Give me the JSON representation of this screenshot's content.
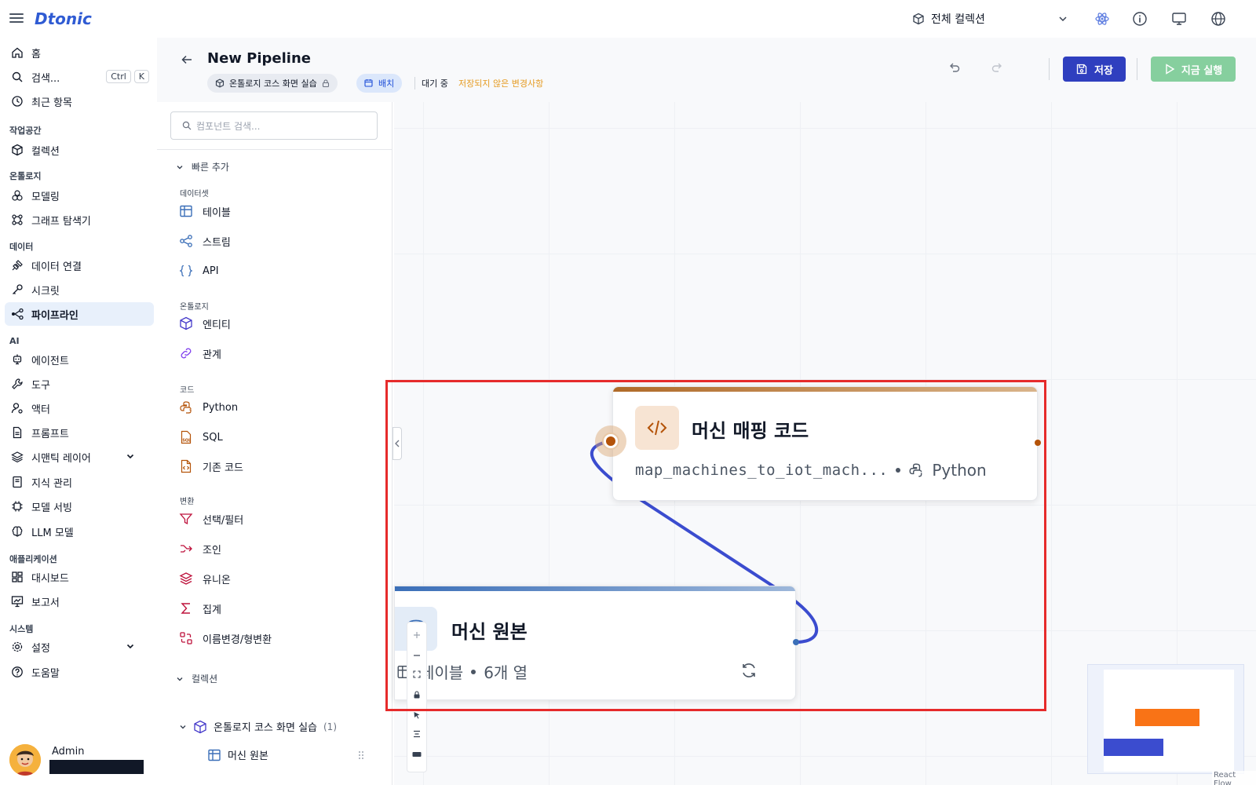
{
  "app": {
    "logo": "Dtonic"
  },
  "topbar": {
    "collection_label": "전체 컬렉션"
  },
  "sidebar": {
    "home": "홈",
    "search": "검색...",
    "search_kbd": [
      "Ctrl",
      "K"
    ],
    "recent": "최근 항목",
    "sections": {
      "workspace": "작업공간",
      "ontology": "온톨로지",
      "data": "데이터",
      "ai": "AI",
      "apps": "애플리케이션",
      "system": "시스템"
    },
    "items": {
      "collection": "컬렉션",
      "modeling": "모델링",
      "graph_explorer": "그래프 탐색기",
      "data_connection": "데이터 연결",
      "secret": "시크릿",
      "pipeline": "파이프라인",
      "agent": "에이전트",
      "tool": "도구",
      "actor": "액터",
      "prompt": "프롬프트",
      "semantic_layer": "시맨틱 레이어",
      "knowledge": "지식 관리",
      "model_serving": "모델 서빙",
      "llm_model": "LLM 모델",
      "dashboard": "대시보드",
      "report": "보고서",
      "settings": "설정",
      "help": "도움말"
    },
    "user_name": "Admin"
  },
  "header": {
    "title": "New Pipeline",
    "collection_chip": "온톨로지 코스 화면 실습",
    "batch_chip": "배치",
    "status": "대기 중",
    "unsaved": "저장되지 않은 변경사항",
    "save_label": "저장",
    "run_label": "지금 실행"
  },
  "panel": {
    "search_placeholder": "컴포넌트 검색...",
    "quick_add": "빠른 추가",
    "categories": {
      "dataset": "데이터셋",
      "ontology": "온톨로지",
      "code": "코드",
      "transform": "변환"
    },
    "components": {
      "table": "테이블",
      "stream": "스트림",
      "api": "API",
      "entity": "엔티티",
      "relation": "관계",
      "python": "Python",
      "sql": "SQL",
      "existing_code": "기존 코드",
      "select_filter": "선택/필터",
      "join": "조인",
      "union": "유니온",
      "aggregate": "집계",
      "rename_cast": "이름변경/형변환"
    },
    "collection_group": "컬렉션",
    "tree": {
      "collection_name": "온톨로지 코스 화면 실습",
      "collection_count": "(1)",
      "child": "머신 원본"
    }
  },
  "canvas": {
    "code_node": {
      "title": "머신 매핑 코드",
      "function": "map_machines_to_iot_mach...",
      "language": "Python"
    },
    "source_node": {
      "title": "머신 원본",
      "kind": "테이블",
      "columns": "6개 열"
    },
    "attribution": "React Flow"
  },
  "colors": {
    "accent": "#2f3fbf",
    "run": "#86cf9e",
    "unsaved": "#e59b21",
    "edge": "#3b4ccf",
    "highlight": "#e62b2b",
    "minimap_code": "#f97316",
    "minimap_src": "#3b4ccf"
  }
}
